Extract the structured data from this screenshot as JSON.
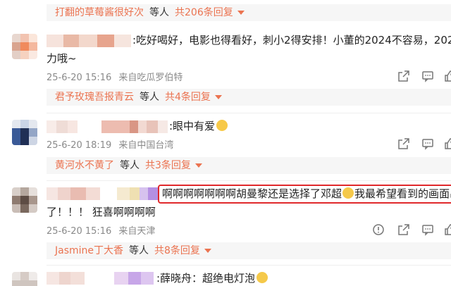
{
  "reply_strips": [
    {
      "name": "打翻的草莓酱很好次",
      "mid": "等人",
      "count": "共206条回复"
    },
    {
      "name": "君予玫瑰吾报青云",
      "mid": "等人",
      "count": "共4条回复"
    },
    {
      "name": "黄河水不黄了",
      "mid": "等人",
      "count": "共3条回复"
    },
    {
      "name": "Jasmine丁大香",
      "mid": "等人",
      "count": "共8条回复"
    }
  ],
  "comments": [
    {
      "text_line1": ":吃好喝好，电影也得看好，刺小2得安排！小董的2024不容易，2025",
      "text_line2": "力哦~",
      "time": "25-6-20 15:16",
      "source": "来自吃瓜罗伯特"
    },
    {
      "text_line1": ":眼中有爱",
      "time": "25-6-20 18:19",
      "source": "来自中国台湾"
    },
    {
      "text_line1_a": "啊啊啊啊啊啊啊胡曼黎还是选择了邓超",
      "text_line1_b": "我最希望看到的画面出",
      "text_line2": "了！！！ 狂喜啊啊啊啊",
      "time": "25-6-20 15:16",
      "source": "来自天津"
    },
    {
      "text_line1": ":薛晓舟：超绝电灯泡"
    }
  ],
  "colors": {
    "accent": "#eb7350",
    "highlight_border": "#e0282b",
    "meta": "#8a8a8a"
  },
  "icons": [
    "share-icon",
    "comment-icon",
    "like-icon",
    "report-icon"
  ]
}
